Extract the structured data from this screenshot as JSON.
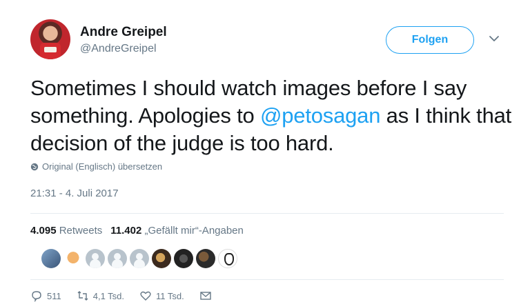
{
  "author": {
    "name": "Andre Greipel",
    "handle": "@AndreGreipel"
  },
  "follow_button": "Folgen",
  "tweet": {
    "text_before": "Sometimes I should watch images before I say something. Apologies to ",
    "mention": "@petosagan",
    "text_after": " as I think that decision of the judge is too hard."
  },
  "translate_link": "Original (Englisch) übersetzen",
  "timestamp": "21:31 - 4. Juli 2017",
  "stats": {
    "retweets_count": "4.095",
    "retweets_label": "Retweets",
    "likes_count": "11.402",
    "likes_label": "„Gefällt mir“-Angaben"
  },
  "actions": {
    "replies": "511",
    "retweets": "4,1 Tsd.",
    "likes": "11 Tsd."
  },
  "colors": {
    "accent": "#1da1f2",
    "secondary_text": "#657786",
    "primary_text": "#14171a"
  },
  "icons": [
    "globe-icon",
    "chevron-down-icon",
    "reply-icon",
    "retweet-icon",
    "heart-icon",
    "message-icon"
  ]
}
